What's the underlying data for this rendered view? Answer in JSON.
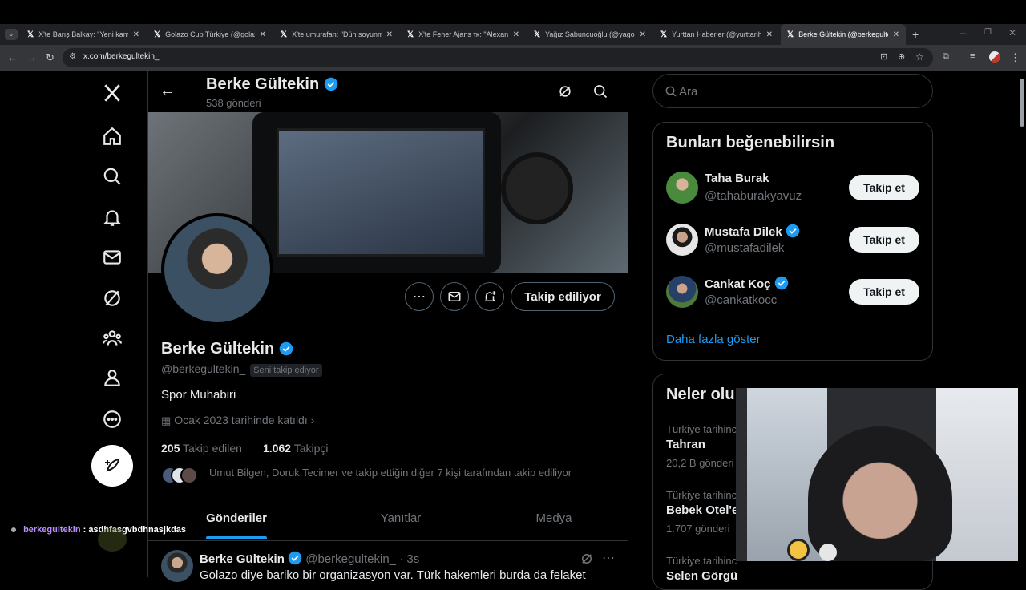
{
  "browser": {
    "tabs": [
      {
        "label": "X'te Barış Balkay: \"Yeni kamera"
      },
      {
        "label": "Golazo Cup Türkiye (@golazoc"
      },
      {
        "label": "X'te umurafan: \"Dün soyunma"
      },
      {
        "label": "X'te Fener Ajans τκ: \"Alexander"
      },
      {
        "label": "Yağız Sabuncuoğlu (@yagosab"
      },
      {
        "label": "Yurttan Haberler (@yurttanhab"
      },
      {
        "label": "Berke Gültekin (@berkegultek"
      }
    ],
    "url": "x.com/berkegultekin_"
  },
  "header": {
    "name": "Berke Gültekin",
    "post_count": "538 gönderi"
  },
  "profile": {
    "name": "Berke Gültekin",
    "handle": "@berkegultekin_",
    "follows_you": "Seni takip ediyor",
    "bio": "Spor Muhabiri",
    "joined": "Ocak 2023 tarihinde katıldı",
    "following_count": "205",
    "following_label": "Takip edilen",
    "followers_count": "1.062",
    "followers_label": "Takipçi",
    "followed_by": "Umut Bilgen, Doruk Tecimer ve takip ettiğin diğer 7 kişi tarafından takip ediliyor",
    "following_button": "Takip ediliyor"
  },
  "tabs": {
    "posts": "Gönderiler",
    "replies": "Yanıtlar",
    "media": "Medya"
  },
  "post": {
    "name": "Berke Gültekin",
    "handle": "@berkegultekin_",
    "time": "· 3s",
    "text": "Golazo diye bariko bir organizasyon var. Türk hakemleri burda da felaket"
  },
  "right": {
    "search_placeholder": "Ara",
    "wtf_title": "Bunları beğenebilirsin",
    "suggestions": [
      {
        "name": "Taha Burak",
        "handle": "@tahaburakyavuz",
        "verified": false,
        "button": "Takip et"
      },
      {
        "name": "Mustafa Dilek",
        "handle": "@mustafadilek",
        "verified": true,
        "button": "Takip et"
      },
      {
        "name": "Cankat Koç",
        "handle": "@cankatkocc",
        "verified": true,
        "button": "Takip et"
      }
    ],
    "show_more": "Daha fazla göster",
    "trends_title": "Neler olu",
    "trends": [
      {
        "context": "Türkiye tarihinc",
        "name": "Tahran",
        "count": "20,2 B gönderi"
      },
      {
        "context": "Türkiye tarihinc",
        "name": "Bebek Otel'e",
        "count": "1.707 gönderi"
      },
      {
        "context": "Türkiye tarihinc",
        "name": "Selen Görgü"
      }
    ]
  },
  "chat": {
    "user": "berkegultekin",
    "message": ": asdhfasgvbdhnasjkdas"
  },
  "colors": {
    "accent": "#1d9bf0",
    "background": "#000000",
    "border": "#2f3336",
    "muted": "#71767b"
  }
}
